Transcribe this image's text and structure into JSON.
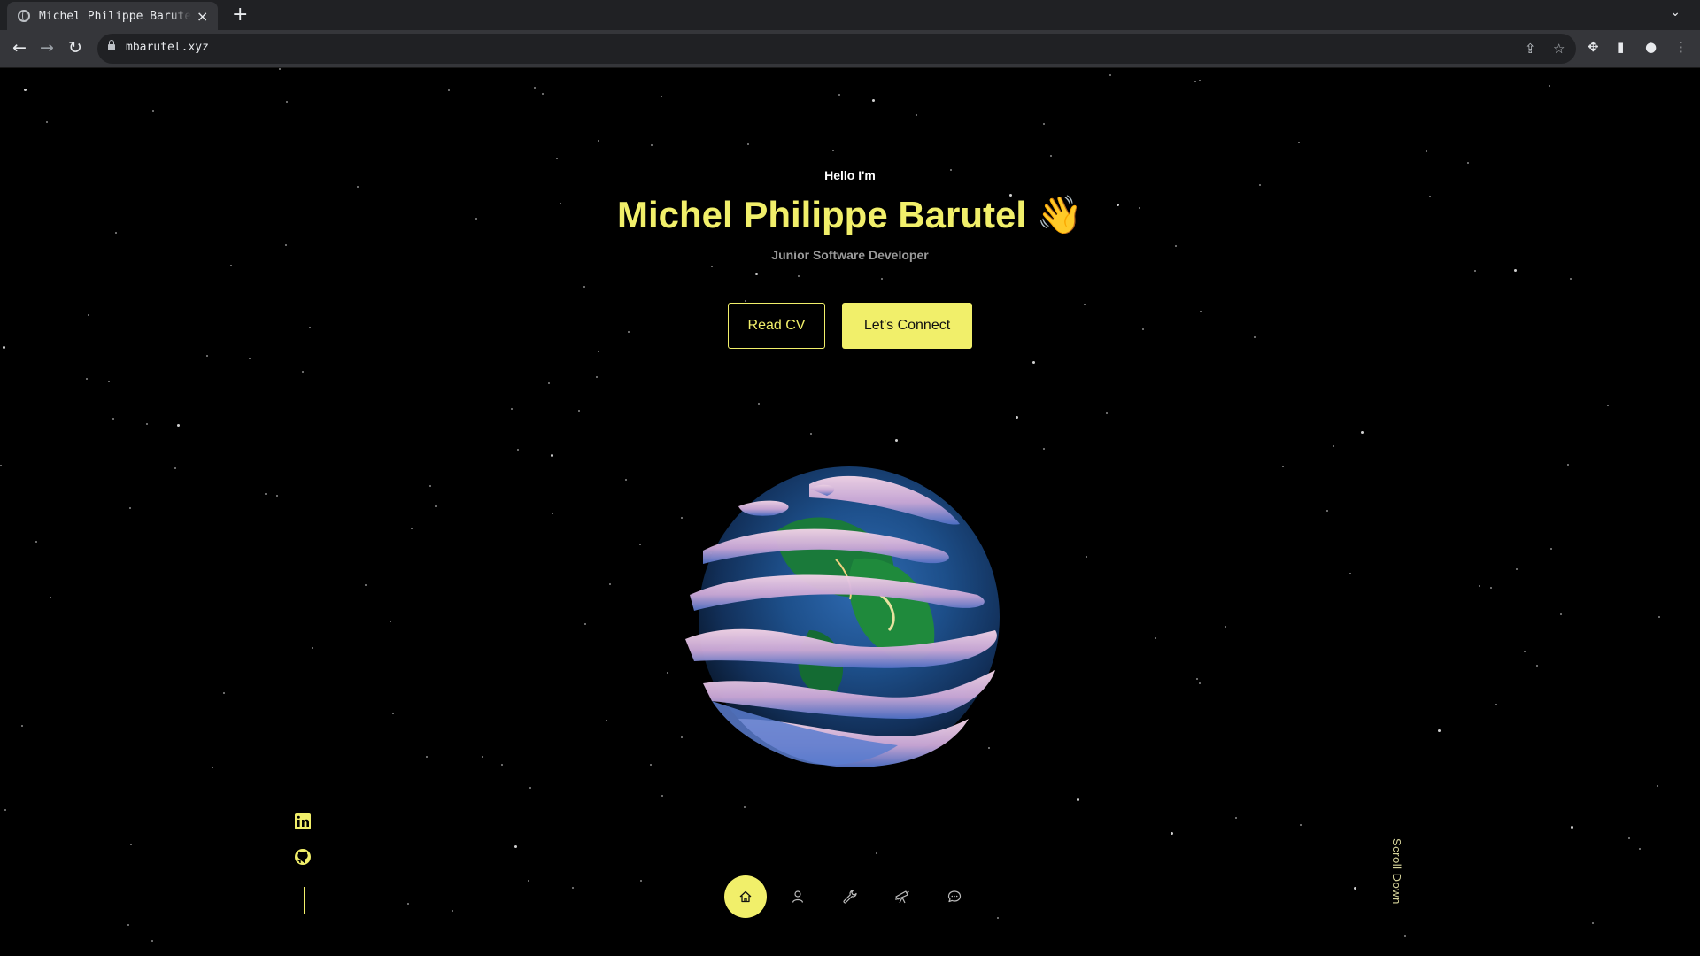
{
  "browser": {
    "tab_title": "Michel Philippe Barutel",
    "url": "mbarutel.xyz"
  },
  "hero": {
    "greeting": "Hello I'm",
    "name": "Michel Philippe Barutel 👋",
    "role": "Junior Software Developer",
    "read_cv_label": "Read CV",
    "connect_label": "Let's Connect"
  },
  "socials": [
    "linkedin-icon",
    "github-icon"
  ],
  "bottom_nav": [
    "home-icon",
    "user-icon",
    "wrench-icon",
    "telescope-icon",
    "chat-icon"
  ],
  "scroll_label": "Scroll Down",
  "colors": {
    "accent": "#f1ef6a",
    "background": "#000000"
  }
}
